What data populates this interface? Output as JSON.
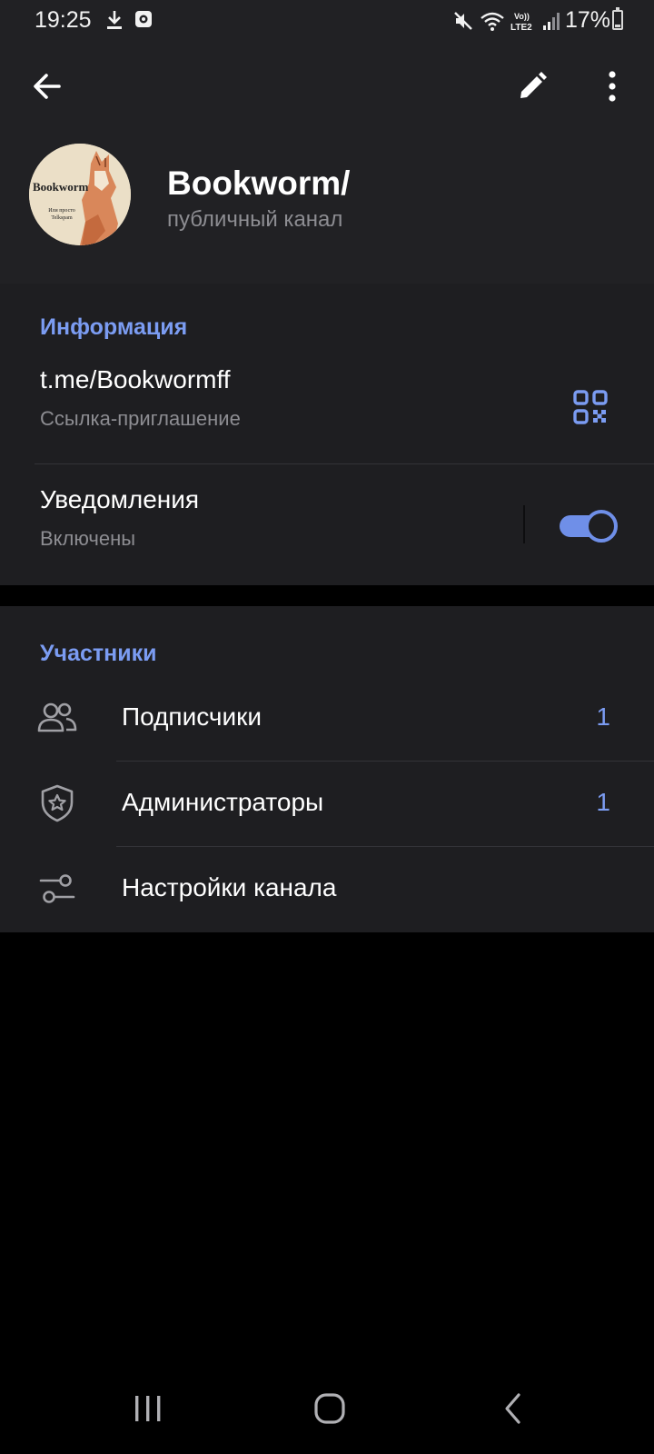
{
  "status_bar": {
    "time": "19:25",
    "network_label": "Vo))\nLTE2",
    "battery_percent": "17%",
    "battery_level": 0.17,
    "icons": [
      "download-icon",
      "app-notification-icon",
      "mute-icon",
      "wifi-icon",
      "signal-icon",
      "battery-icon"
    ]
  },
  "toolbar": {
    "back_icon": "arrow-left-icon",
    "edit_icon": "pencil-icon",
    "more_icon": "more-vertical-icon"
  },
  "channel": {
    "avatar_text": "Bookworm",
    "avatar_subtext": "Или просто\nTelkspam",
    "name": "Bookworm/",
    "type": "публичный канал"
  },
  "info_section": {
    "title": "Информация",
    "link": {
      "value": "t.me/Bookwormff",
      "caption": "Ссылка-приглашение",
      "icon": "qr-code-icon"
    },
    "notifications": {
      "title": "Уведомления",
      "status": "Включены",
      "enabled": true
    }
  },
  "members_section": {
    "title": "Участники",
    "items": [
      {
        "icon": "users-icon",
        "label": "Подписчики",
        "count": "1"
      },
      {
        "icon": "shield-star-icon",
        "label": "Администраторы",
        "count": "1"
      },
      {
        "icon": "sliders-icon",
        "label": "Настройки канала",
        "count": ""
      }
    ]
  },
  "colors": {
    "accent": "#7b9cf2",
    "toggle_on": "#6f8fe8",
    "header_bg": "#212124",
    "card_bg": "#1e1e21",
    "page_bg": "#000000",
    "secondary_text": "#8d8d92"
  },
  "navigation_bar": {
    "icons": [
      "recent-apps-icon",
      "home-icon",
      "back-nav-icon"
    ]
  }
}
